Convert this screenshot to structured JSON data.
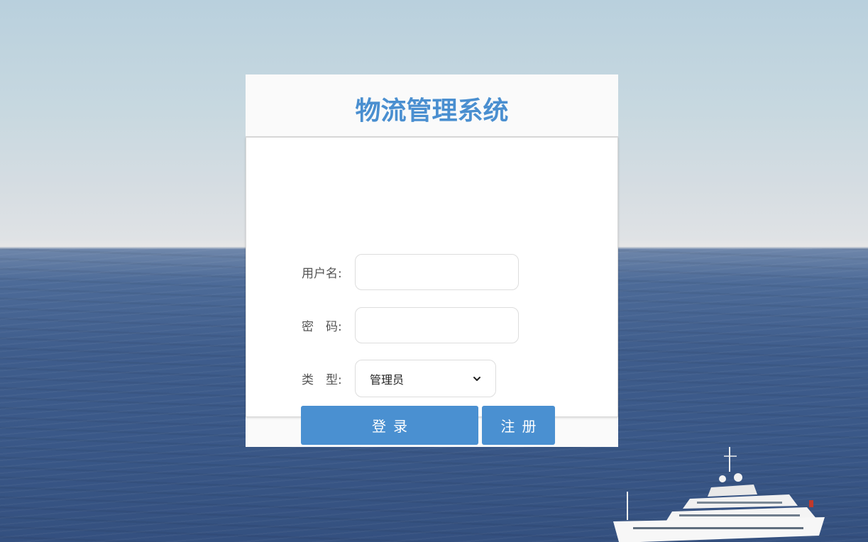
{
  "login_card": {
    "title": "物流管理系统",
    "fields": {
      "username_label": "用户名:",
      "username_value": "",
      "password_label": "密　码:",
      "password_value": "",
      "type_label": "类　型:",
      "type_selected": "管理员"
    },
    "buttons": {
      "login_label": "登录",
      "register_label": "注册"
    }
  },
  "colors": {
    "accent": "#4a90d1",
    "title": "#4a8fd0"
  }
}
